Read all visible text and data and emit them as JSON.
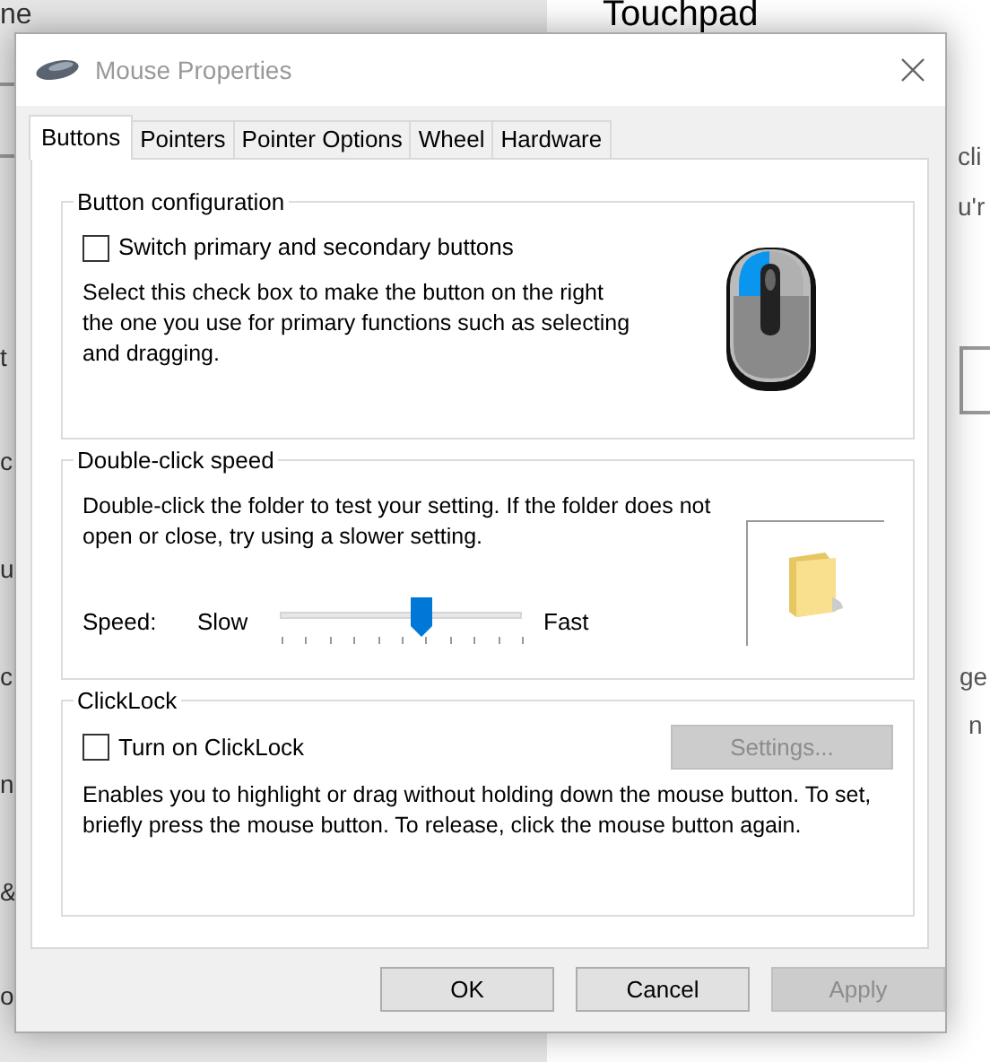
{
  "background": {
    "heading": "Touchpad",
    "top_fragment": "ne",
    "left_fragments": [
      "t",
      "c",
      "u",
      "c",
      "n",
      "&",
      "o"
    ],
    "right_fragments": [
      "cli",
      "u'r",
      "ge",
      "n"
    ]
  },
  "dialog": {
    "title": "Mouse Properties",
    "tabs": [
      {
        "label": "Buttons",
        "selected": true
      },
      {
        "label": "Pointers",
        "selected": false
      },
      {
        "label": "Pointer Options",
        "selected": false
      },
      {
        "label": "Wheel",
        "selected": false
      },
      {
        "label": "Hardware",
        "selected": false
      }
    ],
    "button_configuration": {
      "legend": "Button configuration",
      "checkbox": {
        "label": "Switch primary and secondary buttons",
        "checked": false
      },
      "description": "Select this check box to make the button on the right the one you use for primary functions such as selecting and dragging."
    },
    "double_click_speed": {
      "legend": "Double-click speed",
      "description": "Double-click the folder to test your setting. If the folder does not open or close, try using a slower setting.",
      "speed_label": "Speed:",
      "slow_label": "Slow",
      "fast_label": "Fast",
      "level": 0.59
    },
    "clicklock": {
      "legend": "ClickLock",
      "checkbox": {
        "label": "Turn on ClickLock",
        "checked": false
      },
      "settings_button": {
        "label": "Settings...",
        "disabled": true
      },
      "description": "Enables you to highlight or drag without holding down the mouse button. To set, briefly press the mouse button. To release, click the mouse button again."
    },
    "buttons": [
      {
        "label": "OK",
        "disabled": false
      },
      {
        "label": "Cancel",
        "disabled": false
      },
      {
        "label": "Apply",
        "disabled": true
      }
    ]
  }
}
